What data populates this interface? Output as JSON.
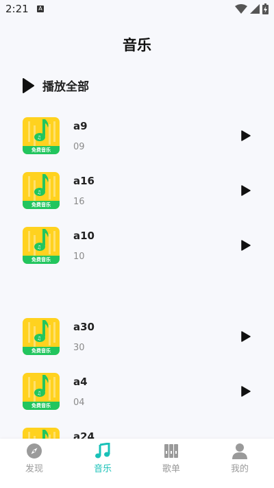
{
  "status": {
    "time": "2:21",
    "notification_icon": "A"
  },
  "header": {
    "title": "音乐"
  },
  "play_all": {
    "label": "播放全部"
  },
  "cover_badge": "免费音乐",
  "songs": [
    {
      "name": "a9",
      "sub": "09"
    },
    {
      "name": "a16",
      "sub": "16"
    },
    {
      "name": "a10",
      "sub": "10"
    },
    {
      "name": "a30",
      "sub": "30"
    },
    {
      "name": "a4",
      "sub": "04"
    },
    {
      "name": "a24",
      "sub": ""
    }
  ],
  "tabs": [
    {
      "label": "发现",
      "icon": "compass-icon"
    },
    {
      "label": "音乐",
      "icon": "music-note-icon"
    },
    {
      "label": "歌单",
      "icon": "books-icon"
    },
    {
      "label": "我的",
      "icon": "person-icon"
    }
  ],
  "colors": {
    "accent": "#19c1b8",
    "cover_yellow": "#ffd21f",
    "cover_green": "#22c55e"
  }
}
